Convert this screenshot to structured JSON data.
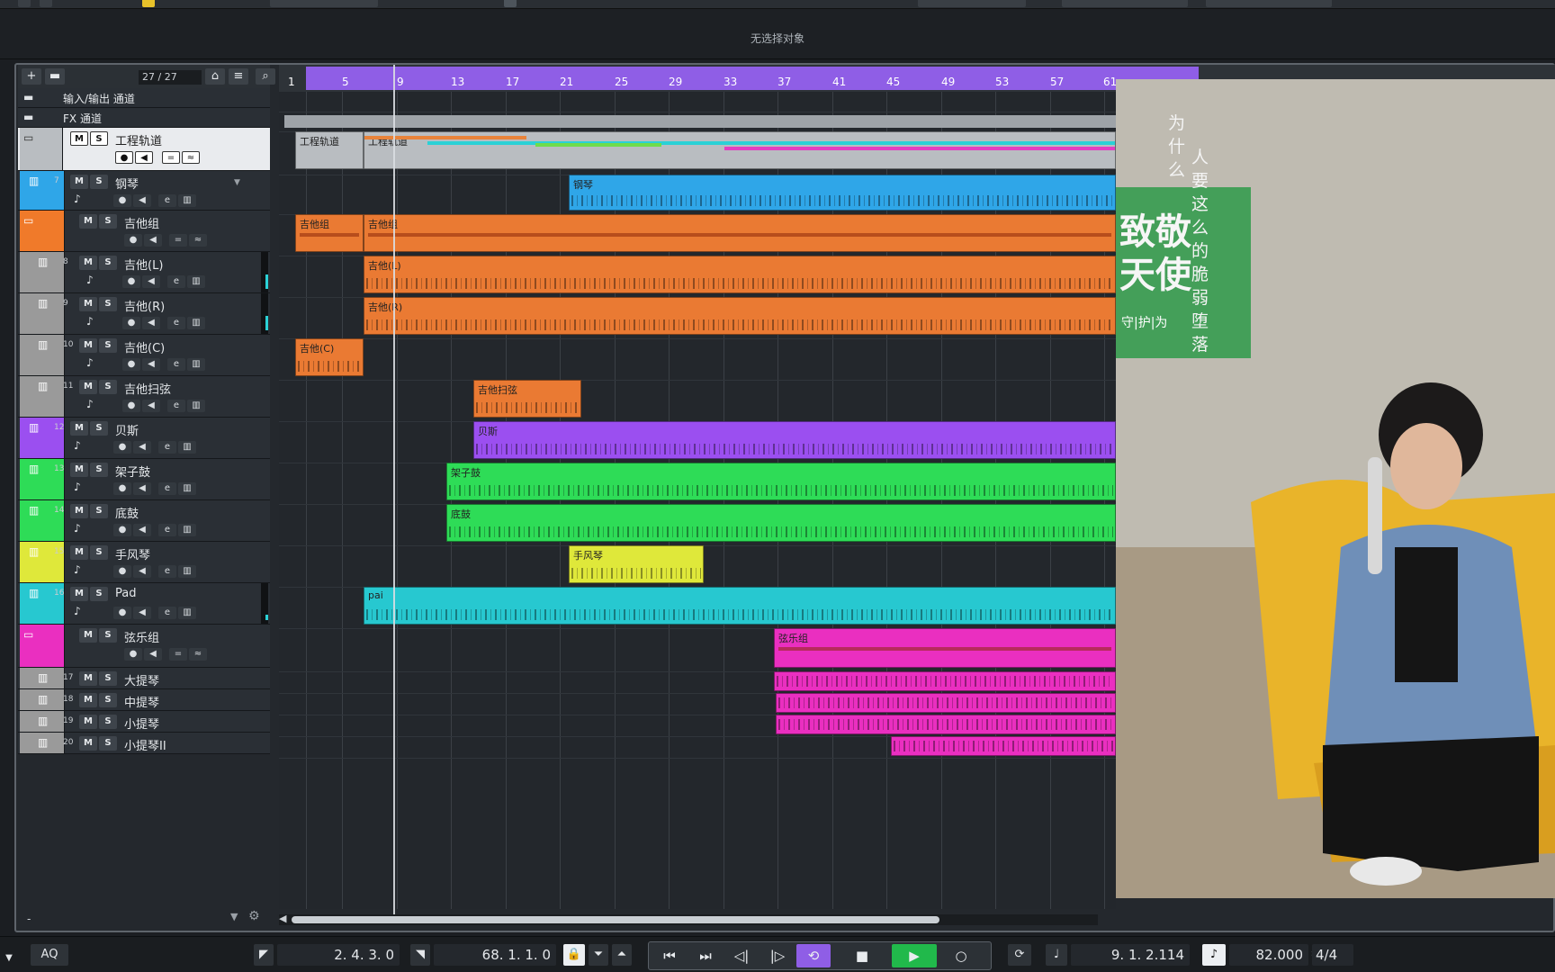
{
  "info_line": "无选择对象",
  "track_list": {
    "count": "27 / 27",
    "tracks": [
      {
        "name": "输入/输出 通道",
        "kind": "folder"
      },
      {
        "name": "FX 通道",
        "kind": "folder"
      },
      {
        "name": "工程轨道",
        "kind": "project"
      },
      {
        "num": "7",
        "name": "钢琴",
        "kind": "instrument",
        "color": "#2fa6e8"
      },
      {
        "name": "吉他组",
        "kind": "group",
        "color": "#f07a2a"
      },
      {
        "num": "8",
        "name": "吉他(L)",
        "kind": "instrument",
        "color": "#9a9a9a"
      },
      {
        "num": "9",
        "name": "吉他(R)",
        "kind": "instrument",
        "color": "#9a9a9a"
      },
      {
        "num": "10",
        "name": "吉他(C)",
        "kind": "instrument",
        "color": "#9a9a9a"
      },
      {
        "num": "11",
        "name": "吉他扫弦",
        "kind": "instrument",
        "color": "#9a9a9a"
      },
      {
        "num": "12",
        "name": "贝斯",
        "kind": "instrument",
        "color": "#9b4ff0"
      },
      {
        "num": "13",
        "name": "架子鼓",
        "kind": "instrument",
        "color": "#2edc57"
      },
      {
        "num": "14",
        "name": "底鼓",
        "kind": "instrument",
        "color": "#2edc57"
      },
      {
        "num": "15",
        "name": "手风琴",
        "kind": "instrument",
        "color": "#dfe83a"
      },
      {
        "num": "16",
        "name": "Pad",
        "kind": "instrument",
        "color": "#27c8d0"
      },
      {
        "name": "弦乐组",
        "kind": "group",
        "color": "#ea2fc0"
      },
      {
        "num": "17",
        "name": "大提琴",
        "kind": "small",
        "color": "#9a9a9a"
      },
      {
        "num": "18",
        "name": "中提琴",
        "kind": "small",
        "color": "#9a9a9a"
      },
      {
        "num": "19",
        "name": "小提琴",
        "kind": "small",
        "color": "#9a9a9a"
      },
      {
        "num": "20",
        "name": "小提琴II",
        "kind": "small",
        "color": "#9a9a9a"
      }
    ],
    "mute": "M",
    "solo": "S",
    "footer_dash": "-"
  },
  "ruler": {
    "bars": [
      "1",
      "5",
      "9",
      "13",
      "17",
      "21",
      "25",
      "29",
      "33",
      "37",
      "41",
      "45",
      "49",
      "53",
      "57",
      "61"
    ]
  },
  "parts": [
    {
      "label": "工程轨道",
      "color": "#b9bdc1"
    },
    {
      "label": "工程轨道",
      "color": "#b9bdc1"
    },
    {
      "label": "钢琴",
      "color": "#2fa6e8"
    },
    {
      "label": "吉他组",
      "color": "#ea7a33"
    },
    {
      "label": "吉他组",
      "color": "#ea7a33"
    },
    {
      "label": "吉他(L)",
      "color": "#ea7a33"
    },
    {
      "label": "吉他(R)",
      "color": "#ea7a33"
    },
    {
      "label": "吉他(C)",
      "color": "#ea7a33"
    },
    {
      "label": "吉他扫弦",
      "color": "#ea7a33"
    },
    {
      "label": "贝斯",
      "color": "#9b4ff0"
    },
    {
      "label": "架子鼓",
      "color": "#2edc57"
    },
    {
      "label": "底鼓",
      "color": "#2edc57"
    },
    {
      "label": "手风琴",
      "color": "#dfe83a"
    },
    {
      "label": "pai",
      "color": "#27c8d0"
    },
    {
      "label": "弦乐组",
      "color": "#ea2fc0"
    },
    {
      "label": "",
      "color": "#ea2fc0"
    },
    {
      "label": "",
      "color": "#ea2fc0"
    },
    {
      "label": "",
      "color": "#ea2fc0"
    },
    {
      "label": "",
      "color": "#ea2fc0"
    }
  ],
  "video": {
    "caption_left": "为什么",
    "caption_right": "人要这么的脆弱堕落",
    "sign_text": "致敬天使",
    "sign_sub": "守|护|为"
  },
  "transport": {
    "aq": "AQ",
    "left_locator": "2. 4. 3.   0",
    "right_locator": "68. 1. 1.   0",
    "position": "9. 1. 2.114",
    "tempo": "82.000",
    "signature": "4/4"
  },
  "colors": {
    "cycle": "#8f5ee6",
    "play": "#21b94b",
    "accent_cyan": "#2ad1d6"
  }
}
